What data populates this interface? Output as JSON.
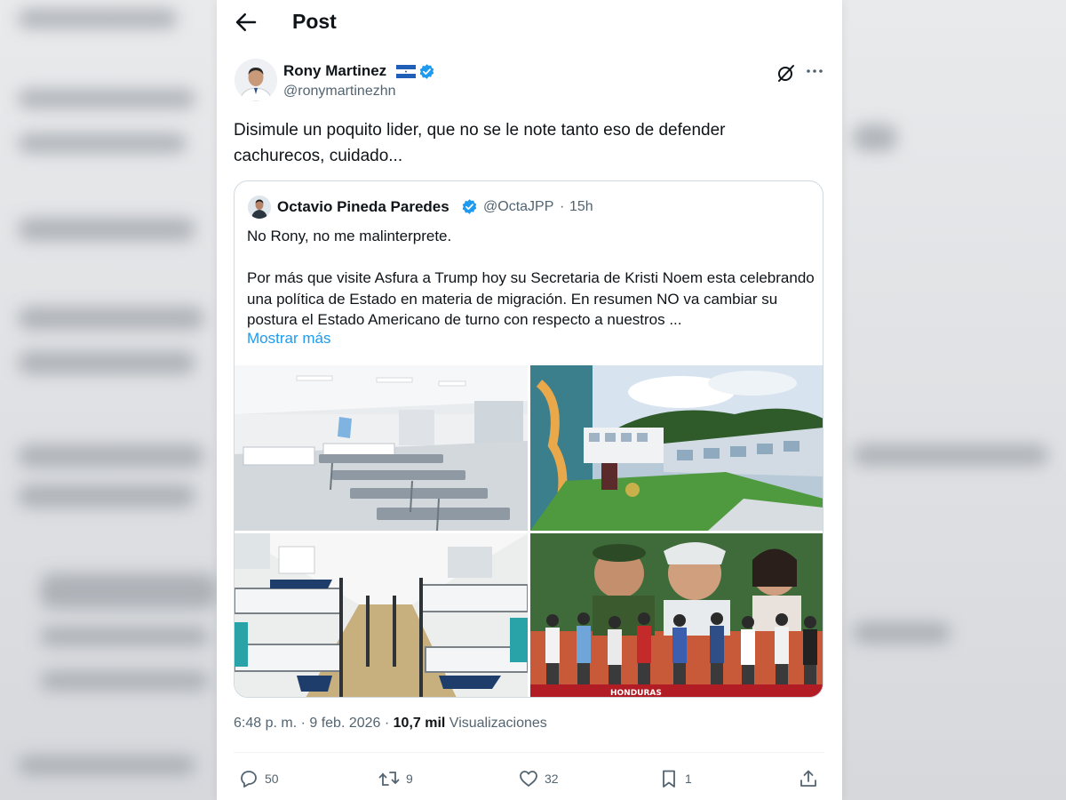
{
  "header": {
    "title": "Post"
  },
  "tweet": {
    "author_name": "Rony Martinez",
    "handle": "@ronymartinezhn",
    "text": "Disimule un poquito lider, que no se le note tanto eso de defender cachurecos, cuidado...",
    "timestamp": "6:48 p. m. · 9 feb. 2026 · ",
    "views_count": "10,7 mil",
    "views_label": " Visualizaciones"
  },
  "quote": {
    "author_name": "Octavio Pineda Paredes",
    "handle": "@OctaJPP",
    "separator": "·",
    "time": "15h",
    "text": "No Rony, no me malinterprete.\n\nPor más que visite Asfura a Trump hoy su Secretaria de Kristi Noem esta celebrando una política de Estado en materia de migración. En resumen NO va cambiar su postura el Estado Americano de turno con respecto a nuestros ...",
    "show_more": "Mostrar más",
    "images": [
      {
        "alt": "waiting-room-photo"
      },
      {
        "alt": "building-courtyard-photo"
      },
      {
        "alt": "bunk-beds-photo"
      },
      {
        "alt": "event-crowd-photo",
        "banner_text": "HONDURAS"
      }
    ]
  },
  "actions": {
    "replies": "50",
    "reposts": "9",
    "likes": "32",
    "bookmarks": "1"
  },
  "colors": {
    "accent": "#1d9bf0",
    "secondary_text": "#536471",
    "border": "#cfd9de"
  }
}
